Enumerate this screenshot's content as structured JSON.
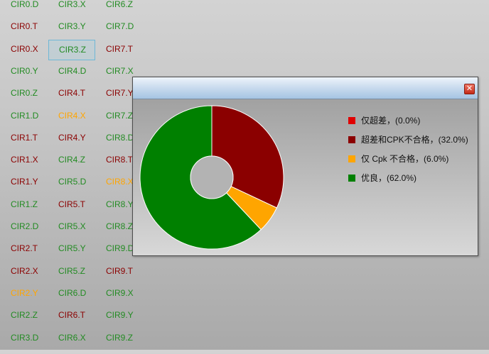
{
  "colors": {
    "green": "#228b22",
    "red": "#8b0000",
    "orange": "#ffa500"
  },
  "grid": {
    "columns": [
      [
        {
          "label": "CIR0.D",
          "status": "green"
        },
        {
          "label": "CIR0.T",
          "status": "red"
        },
        {
          "label": "CIR0.X",
          "status": "red"
        },
        {
          "label": "CIR0.Y",
          "status": "green"
        },
        {
          "label": "CIR0.Z",
          "status": "green"
        },
        {
          "label": "CIR1.D",
          "status": "green"
        },
        {
          "label": "CIR1.T",
          "status": "red"
        },
        {
          "label": "CIR1.X",
          "status": "red"
        },
        {
          "label": "CIR1.Y",
          "status": "red"
        },
        {
          "label": "CIR1.Z",
          "status": "green"
        },
        {
          "label": "CIR2.D",
          "status": "green"
        },
        {
          "label": "CIR2.T",
          "status": "red"
        },
        {
          "label": "CIR2.X",
          "status": "red"
        },
        {
          "label": "CIR2.Y",
          "status": "orange"
        },
        {
          "label": "CIR2.Z",
          "status": "green"
        },
        {
          "label": "CIR3.D",
          "status": "green"
        }
      ],
      [
        {
          "label": "CIR3.X",
          "status": "green"
        },
        {
          "label": "CIR3.Y",
          "status": "green"
        },
        {
          "label": "CIR3.Z",
          "status": "green",
          "selected": true
        },
        {
          "label": "CIR4.D",
          "status": "green"
        },
        {
          "label": "CIR4.T",
          "status": "red"
        },
        {
          "label": "CIR4.X",
          "status": "orange"
        },
        {
          "label": "CIR4.Y",
          "status": "red"
        },
        {
          "label": "CIR4.Z",
          "status": "green"
        },
        {
          "label": "CIR5.D",
          "status": "green"
        },
        {
          "label": "CIR5.T",
          "status": "red"
        },
        {
          "label": "CIR5.X",
          "status": "green"
        },
        {
          "label": "CIR5.Y",
          "status": "green"
        },
        {
          "label": "CIR5.Z",
          "status": "green"
        },
        {
          "label": "CIR6.D",
          "status": "green"
        },
        {
          "label": "CIR6.T",
          "status": "red"
        },
        {
          "label": "CIR6.X",
          "status": "green"
        }
      ],
      [
        {
          "label": "CIR6.Z",
          "status": "green"
        },
        {
          "label": "CIR7.D",
          "status": "green"
        },
        {
          "label": "CIR7.T",
          "status": "red"
        },
        {
          "label": "CIR7.X",
          "status": "green"
        },
        {
          "label": "CIR7.Y",
          "status": "red"
        },
        {
          "label": "CIR7.Z",
          "status": "green"
        },
        {
          "label": "CIR8.D",
          "status": "green"
        },
        {
          "label": "CIR8.T",
          "status": "red"
        },
        {
          "label": "CIR8.X",
          "status": "orange"
        },
        {
          "label": "CIR8.Y",
          "status": "green"
        },
        {
          "label": "CIR8.Z",
          "status": "green"
        },
        {
          "label": "CIR9.D",
          "status": "green"
        },
        {
          "label": "CIR9.T",
          "status": "red"
        },
        {
          "label": "CIR9.X",
          "status": "green"
        },
        {
          "label": "CIR9.Y",
          "status": "green"
        },
        {
          "label": "CIR9.Z",
          "status": "green"
        }
      ]
    ]
  },
  "popup": {
    "close_icon": "close-icon"
  },
  "chart_data": {
    "type": "pie",
    "donut": true,
    "categories": [
      "仅超差，(0.0%)",
      "超差和CPK不合格，(32.0%)",
      "仅 Cpk 不合格，(6.0%)",
      "优良，(62.0%)"
    ],
    "values": [
      0.0,
      32.0,
      6.0,
      62.0
    ],
    "colors": [
      "#e00000",
      "#8b0000",
      "#ffa500",
      "#008000"
    ],
    "legend_position": "right"
  }
}
